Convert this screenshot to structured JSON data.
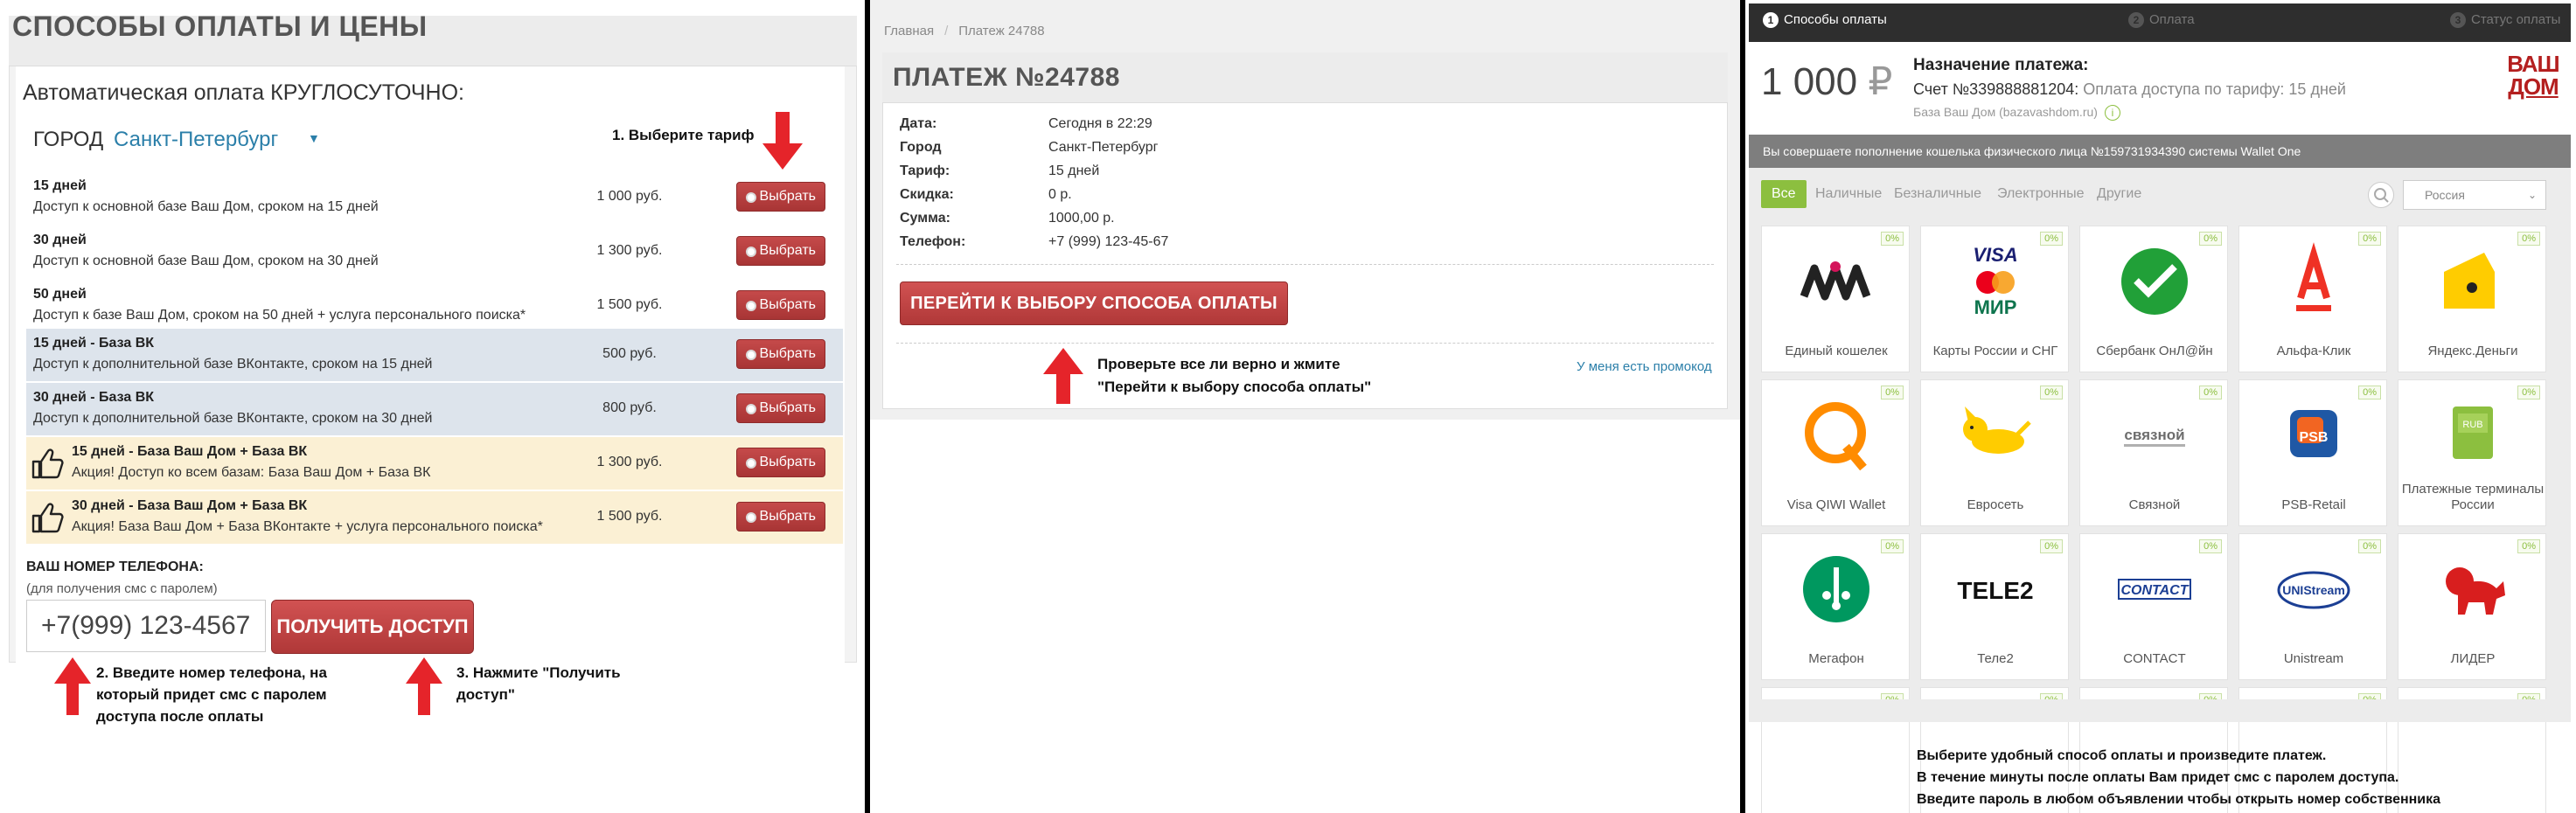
{
  "panel1": {
    "title": "СПОСОБЫ ОПЛАТЫ И ЦЕНЫ",
    "subtitle": "Автоматическая оплата КРУГЛОСУТОЧНО:",
    "city_label": "ГОРОД",
    "city_value": "Санкт-Петербург",
    "step1_note": "1. Выберите тариф",
    "select_label": "Выбрать",
    "tariffs": [
      {
        "name": "15 дней",
        "desc": "Доступ к основной базе Ваш Дом, сроком на 15 дней",
        "price": "1 000 руб."
      },
      {
        "name": "30 дней",
        "desc": "Доступ к основной базе Ваш Дом, сроком на 30 дней",
        "price": "1 300 руб."
      },
      {
        "name": "50 дней",
        "desc": "Доступ к базе Ваш Дом, сроком на 50 дней + услуга персонального поиска*",
        "price": "1 500 руб."
      },
      {
        "name": "15 дней - База ВК",
        "desc": "Доступ к дополнительной базе ВКонтакте, сроком на 15 дней",
        "price": "500 руб."
      },
      {
        "name": "30 дней - База ВК",
        "desc": "Доступ к дополнительной базе ВКонтакте, сроком на 30 дней",
        "price": "800 руб."
      },
      {
        "name": "15 дней - База Ваш Дом + База ВК",
        "desc": "Акция! Доступ ко всем базам: База Ваш Дом + База ВК",
        "price": "1 300 руб."
      },
      {
        "name": "30 дней - База Ваш Дом + База ВК",
        "desc": "Акция! База Ваш Дом + База ВКонтакте + услуга персонального поиска*",
        "price": "1 500 руб."
      }
    ],
    "phone_heading": "ВАШ НОМЕР ТЕЛЕФОНА:",
    "phone_sub": "(для получения смс с паролем)",
    "phone_value": "+7(999) 123-4567",
    "get_access_label": "ПОЛУЧИТЬ ДОСТУП",
    "step2_note": "2. Введите номер телефона, на который придет смс с паролем доступа после оплаты",
    "step3_note": "3. Нажмите \"Получить доступ\""
  },
  "panel2": {
    "breadcrumb_home": "Главная",
    "breadcrumb_sep": "/",
    "breadcrumb_current": "Платеж 24788",
    "title": "ПЛАТЕЖ №24788",
    "rows": [
      {
        "label": "Дата:",
        "value": "Сегодня в 22:29"
      },
      {
        "label": "Город",
        "value": "Санкт-Петербург"
      },
      {
        "label": "Тариф:",
        "value": "15 дней"
      },
      {
        "label": "Скидка:",
        "value": "0 р."
      },
      {
        "label": "Сумма:",
        "value": "1000,00 р."
      },
      {
        "label": "Телефон:",
        "value": "+7 (999) 123-45-67"
      }
    ],
    "go_button": "ПЕРЕЙТИ К ВЫБОРУ СПОСОБА ОПЛАТЫ",
    "note": "Проверьте все ли верно и жмите \"Перейти к выбору способа оплаты\"",
    "promo_link": "У меня есть промокод"
  },
  "panel3": {
    "steps": [
      {
        "num": "1",
        "label": "Способы оплаты"
      },
      {
        "num": "2",
        "label": "Оплата"
      },
      {
        "num": "3",
        "label": "Статус оплаты"
      }
    ],
    "amount": "1 000",
    "currency": "₽",
    "purpose_heading": "Назначение платежа:",
    "purpose_invoice": "Счет №339888881204:",
    "purpose_text": "Оплата доступа по тарифу: 15 дней",
    "purpose_site": "База Ваш Дом (bazavashdom.ru)",
    "logo_text_1": "ВАШ",
    "logo_text_2": "ДОМ",
    "banner": "Вы совершаете пополнение кошелька физического лица №159731934390 системы Wallet One",
    "filters": [
      "Все",
      "Наличные",
      "Безналичные",
      "Электронные",
      "Другие"
    ],
    "country": "Россия",
    "badge": "0%",
    "methods": [
      {
        "label": "Единый кошелек",
        "icon": "w1-icon"
      },
      {
        "label": "Карты России и СНГ",
        "icon": "cards-icon"
      },
      {
        "label": "Сбербанк ОнЛ@йн",
        "icon": "sberbank-icon"
      },
      {
        "label": "Альфа-Клик",
        "icon": "alfa-icon"
      },
      {
        "label": "Яндекс.Деньги",
        "icon": "yandex-money-icon"
      },
      {
        "label": "Visa QIWI Wallet",
        "icon": "qiwi-icon"
      },
      {
        "label": "Евросеть",
        "icon": "euroset-icon"
      },
      {
        "label": "Связной",
        "icon": "svyaznoy-icon"
      },
      {
        "label": "PSB-Retail",
        "icon": "psb-icon"
      },
      {
        "label": "Платежные терминалы России",
        "icon": "terminal-icon"
      },
      {
        "label": "Мегафон",
        "icon": "megafon-icon"
      },
      {
        "label": "Теле2",
        "icon": "tele2-icon"
      },
      {
        "label": "CONTACT",
        "icon": "contact-icon"
      },
      {
        "label": "Unistream",
        "icon": "unistream-icon"
      },
      {
        "label": "ЛИДЕР",
        "icon": "lider-icon"
      }
    ],
    "note_lines": [
      "Выберите удобный способ оплаты и произведите платеж.",
      "В течение минуты после оплаты Вам придет смс с паролем доступа.",
      "Введите пароль в любом объявлении чтобы открыть номер собственника"
    ],
    "colors": {
      "accent_green": "#8cbf3f",
      "button_red": "#b03838",
      "topbar": "#2e2e2e"
    }
  }
}
